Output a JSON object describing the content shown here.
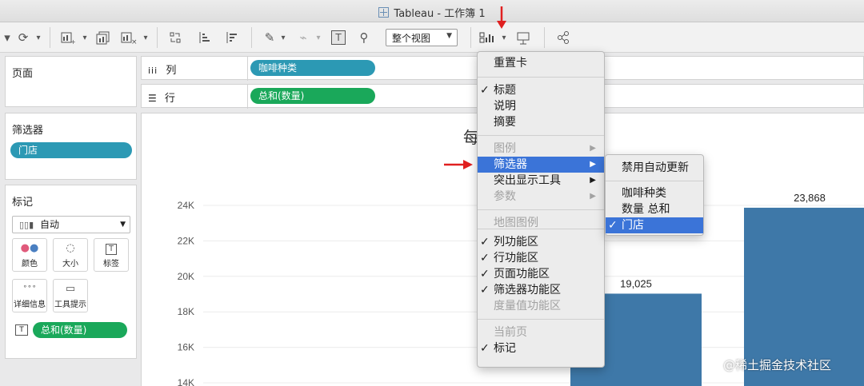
{
  "window": {
    "title": "Tableau - 工作簿 1"
  },
  "toolbar": {
    "fit_value": "整个视图",
    "icons": [
      "redo-icon",
      "new-chart-icon",
      "duplicate-sheet-icon",
      "clear-sheet-icon",
      "swap-icon",
      "sort-asc-icon",
      "sort-desc-icon",
      "highlight-icon",
      "clip-icon",
      "label-icon",
      "pin-icon",
      "show-me-icon",
      "presentation-icon",
      "share-icon"
    ]
  },
  "panels": {
    "pages_label": "页面",
    "filters_label": "筛选器",
    "filter_pill": "门店",
    "marks_label": "标记",
    "marks_type": "自动",
    "mark_buttons": [
      "颜色",
      "大小",
      "标签",
      "详细信息",
      "工具提示"
    ],
    "marks_pill": "总和(数量)"
  },
  "shelves": {
    "columns_label": "列",
    "columns_pill": "咖啡种类",
    "rows_label": "行",
    "rows_pill": "总和(数量)"
  },
  "view": {
    "title_visible": "每"
  },
  "chart_data": {
    "type": "bar",
    "y_ticks": [
      "24K",
      "22K",
      "20K",
      "18K",
      "16K",
      "14K"
    ],
    "ylim": [
      14000,
      24000
    ],
    "bars": [
      {
        "value": 19025,
        "label": "19,025"
      },
      {
        "value": 23868,
        "label": "23,868"
      }
    ],
    "bar_color": "#3e78a8"
  },
  "menu": {
    "items": [
      {
        "label": "重置卡",
        "check": "",
        "disabled": false,
        "sub": false
      },
      {
        "label": "标题",
        "check": "✓",
        "disabled": false,
        "sub": false
      },
      {
        "label": "说明",
        "check": "",
        "disabled": false,
        "sub": false
      },
      {
        "label": "摘要",
        "check": "",
        "disabled": false,
        "sub": false
      },
      {
        "label": "图例",
        "check": "",
        "disabled": true,
        "sub": true
      },
      {
        "label": "筛选器",
        "check": "",
        "disabled": false,
        "sub": true
      },
      {
        "label": "突出显示工具",
        "check": "",
        "disabled": false,
        "sub": true
      },
      {
        "label": "参数",
        "check": "",
        "disabled": true,
        "sub": true
      },
      {
        "label": "地图图例",
        "check": "",
        "disabled": true,
        "sub": false
      },
      {
        "label": "列功能区",
        "check": "✓",
        "disabled": false,
        "sub": false
      },
      {
        "label": "行功能区",
        "check": "✓",
        "disabled": false,
        "sub": false
      },
      {
        "label": "页面功能区",
        "check": "✓",
        "disabled": false,
        "sub": false
      },
      {
        "label": "筛选器功能区",
        "check": "✓",
        "disabled": false,
        "sub": false
      },
      {
        "label": "度量值功能区",
        "check": "",
        "disabled": true,
        "sub": false
      },
      {
        "label": "当前页",
        "check": "",
        "disabled": true,
        "sub": false
      },
      {
        "label": "标记",
        "check": "✓",
        "disabled": false,
        "sub": false
      }
    ]
  },
  "submenu": {
    "items": [
      {
        "label": "禁用自动更新",
        "check": ""
      },
      {
        "label": "咖啡种类",
        "check": ""
      },
      {
        "label": "数量 总和",
        "check": ""
      },
      {
        "label": "门店",
        "check": "✓"
      }
    ]
  },
  "watermark": "@稀土掘金技术社区"
}
